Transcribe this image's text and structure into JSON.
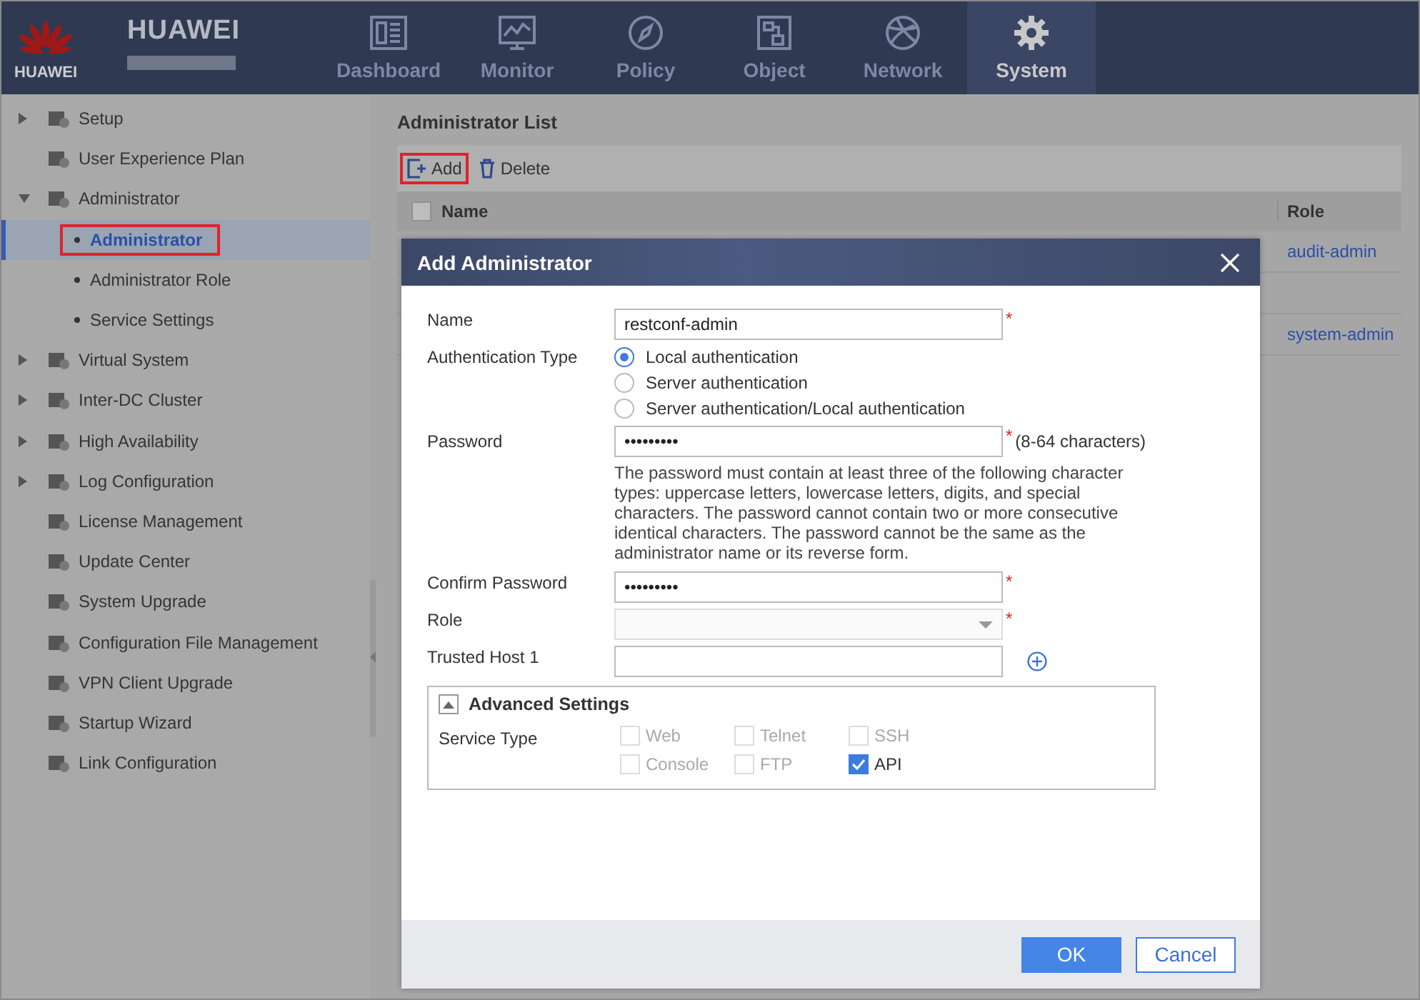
{
  "brand": {
    "logo_text": "HUAWEI",
    "name": "HUAWEI"
  },
  "nav": [
    {
      "label": "Dashboard",
      "selected": false
    },
    {
      "label": "Monitor",
      "selected": false
    },
    {
      "label": "Policy",
      "selected": false
    },
    {
      "label": "Object",
      "selected": false
    },
    {
      "label": "Network",
      "selected": false
    },
    {
      "label": "System",
      "selected": true
    }
  ],
  "sidebar": {
    "items": [
      {
        "label": "Setup",
        "expandable": true,
        "expanded": false
      },
      {
        "label": "User Experience Plan",
        "expandable": false
      },
      {
        "label": "Administrator",
        "expandable": true,
        "expanded": true,
        "children": [
          {
            "label": "Administrator",
            "selected": true,
            "highlighted": true
          },
          {
            "label": "Administrator Role",
            "selected": false,
            "highlighted": false
          },
          {
            "label": "Service Settings",
            "selected": false,
            "highlighted": false
          }
        ]
      },
      {
        "label": "Virtual System",
        "expandable": true,
        "expanded": false
      },
      {
        "label": "Inter-DC Cluster",
        "expandable": true,
        "expanded": false
      },
      {
        "label": "High Availability",
        "expandable": true,
        "expanded": false
      },
      {
        "label": "Log Configuration",
        "expandable": true,
        "expanded": false
      },
      {
        "label": "License Management",
        "expandable": false
      },
      {
        "label": "Update Center",
        "expandable": false
      },
      {
        "label": "System Upgrade",
        "expandable": false
      },
      {
        "label": "Configuration File Management",
        "expandable": false
      },
      {
        "label": "VPN Client Upgrade",
        "expandable": false
      },
      {
        "label": "Startup Wizard",
        "expandable": false
      },
      {
        "label": "Link Configuration",
        "expandable": false
      }
    ]
  },
  "main": {
    "title": "Administrator List",
    "toolbar": [
      {
        "label": "Add",
        "highlighted": true
      },
      {
        "label": "Delete",
        "highlighted": false
      }
    ],
    "table": {
      "select_all_checked": false,
      "columns": [
        "Name",
        "Role"
      ],
      "rows": [
        {
          "role": "audit-admin"
        },
        {},
        {
          "role": "system-admin"
        }
      ]
    }
  },
  "dialog": {
    "title": "Add Administrator",
    "name": {
      "label": "Name",
      "value": "restconf-admin",
      "required_mark": "*"
    },
    "auth": {
      "label": "Authentication Type",
      "options": [
        {
          "label": "Local authentication",
          "selected": true
        },
        {
          "label": "Server authentication",
          "selected": false
        },
        {
          "label": "Server authentication/Local authentication",
          "selected": false
        }
      ]
    },
    "password": {
      "label": "Password",
      "value": "•••••••••",
      "required_mark": "*",
      "hint": "(8-64 characters)",
      "help": "The password must contain at least three of the following character types: uppercase letters, lowercase letters, digits, and special characters. The password cannot contain two or more consecutive identical characters. The password cannot be the same as the administrator name or its reverse form."
    },
    "confirm": {
      "label": "Confirm Password",
      "value": "•••••••••",
      "required_mark": "*"
    },
    "role": {
      "label": "Role",
      "required_mark": "*",
      "disabled": true
    },
    "trusted_host": {
      "label": "Trusted Host 1"
    },
    "advanced": {
      "title": "Advanced Settings",
      "expanded": true,
      "service_label": "Service Type",
      "services": [
        {
          "label": "Web",
          "checked": false,
          "disabled": true
        },
        {
          "label": "Telnet",
          "checked": false,
          "disabled": true
        },
        {
          "label": "SSH",
          "checked": false,
          "disabled": true
        },
        {
          "label": "Console",
          "checked": false,
          "disabled": true
        },
        {
          "label": "FTP",
          "checked": false,
          "disabled": true
        },
        {
          "label": "API",
          "checked": true,
          "disabled": false
        }
      ]
    },
    "buttons": [
      {
        "label": "OK",
        "primary": true
      },
      {
        "label": "Cancel",
        "primary": false
      }
    ]
  }
}
